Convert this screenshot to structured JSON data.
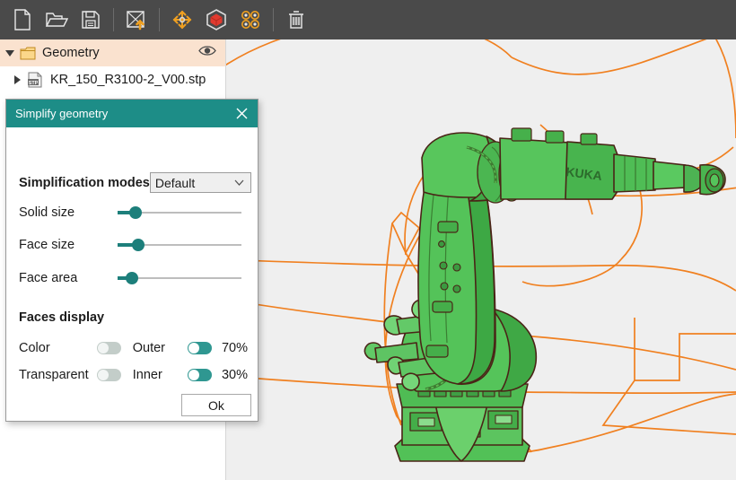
{
  "toolbar": {
    "items": [
      {
        "name": "new-file-icon",
        "label": "New"
      },
      {
        "name": "open-folder-icon",
        "label": "Open"
      },
      {
        "name": "save-icon",
        "label": "Save"
      },
      {
        "name": "import-geometry-icon",
        "label": "Import geometry"
      },
      {
        "name": "move-tool-icon",
        "label": "Move"
      },
      {
        "name": "cube-icon",
        "label": "Solid view"
      },
      {
        "name": "simplify-geometry-icon",
        "label": "Simplify geometry"
      },
      {
        "name": "delete-icon",
        "label": "Delete"
      }
    ]
  },
  "tree": {
    "root": {
      "label": "Geometry",
      "expanded": true,
      "visibility_icon": "eye-icon"
    },
    "children": [
      {
        "label": "KR_150_R3100-2_V00.stp",
        "expanded": false,
        "file_icon": "stp-file-icon",
        "file_icon_text": "STP"
      }
    ]
  },
  "dialog": {
    "title": "Simplify geometry",
    "close_icon": "close-icon",
    "modes": {
      "label": "Simplification modes",
      "selected": "Default",
      "options": [
        "Default"
      ]
    },
    "sliders": [
      {
        "label": "Solid size",
        "value": 14,
        "min": 0,
        "max": 100
      },
      {
        "label": "Face size",
        "value": 16,
        "min": 0,
        "max": 100
      },
      {
        "label": "Face area",
        "value": 11,
        "min": 0,
        "max": 100
      }
    ],
    "faces_display": {
      "title": "Faces display",
      "rows": [
        {
          "name": "Color",
          "left_on": false,
          "mid": "Outer",
          "right_on": true,
          "percent": "70%"
        },
        {
          "name": "Transparent",
          "left_on": false,
          "mid": "Inner",
          "right_on": true,
          "percent": "30%"
        }
      ]
    },
    "ok_label": "Ok"
  },
  "viewport": {
    "model_name": "KUKA KR 150 R3100-2",
    "brand_text": "KUKA",
    "background_color": "#efefef",
    "model_color": "#4cb84c",
    "edge_color": "#4a2417",
    "envelope_color": "#f08020"
  }
}
